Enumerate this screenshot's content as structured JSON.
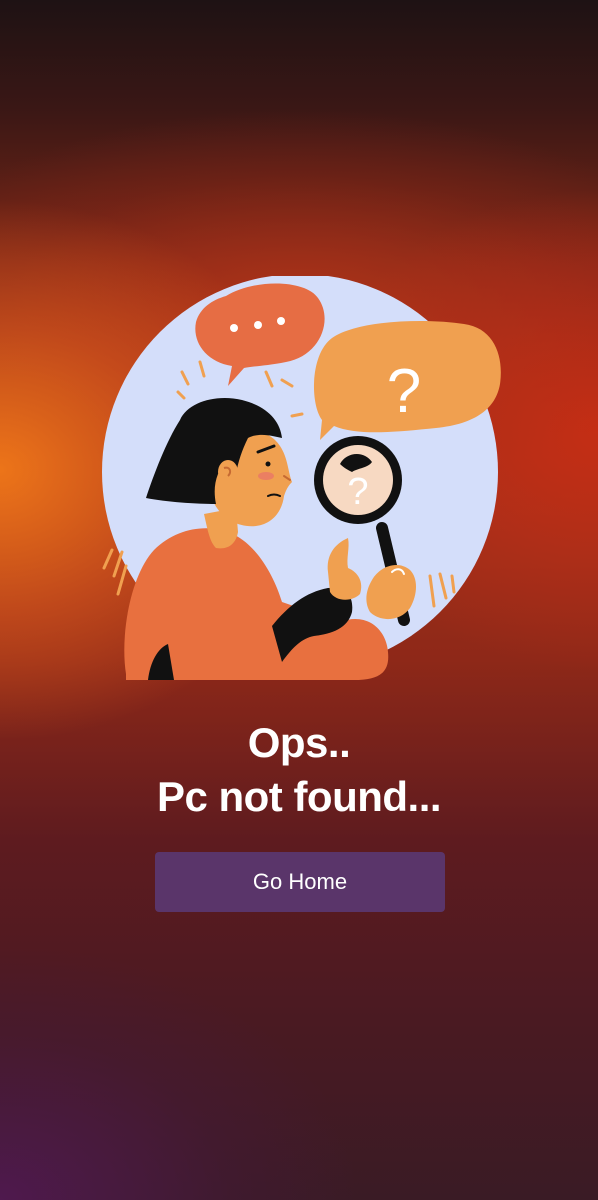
{
  "illustration": {
    "name": "person-with-magnifying-glass",
    "bubble_left_text": "• • •",
    "bubble_right_text": "?",
    "lens_text": "?"
  },
  "message": {
    "line1": "Ops..",
    "line2": "Pc not found..."
  },
  "actions": {
    "go_home_label": "Go Home"
  },
  "colors": {
    "circle": "#d4defa",
    "bubble_left": "#e66d44",
    "bubble_right": "#f0a050",
    "shirt": "#e8703f",
    "button": "#5a356a"
  }
}
